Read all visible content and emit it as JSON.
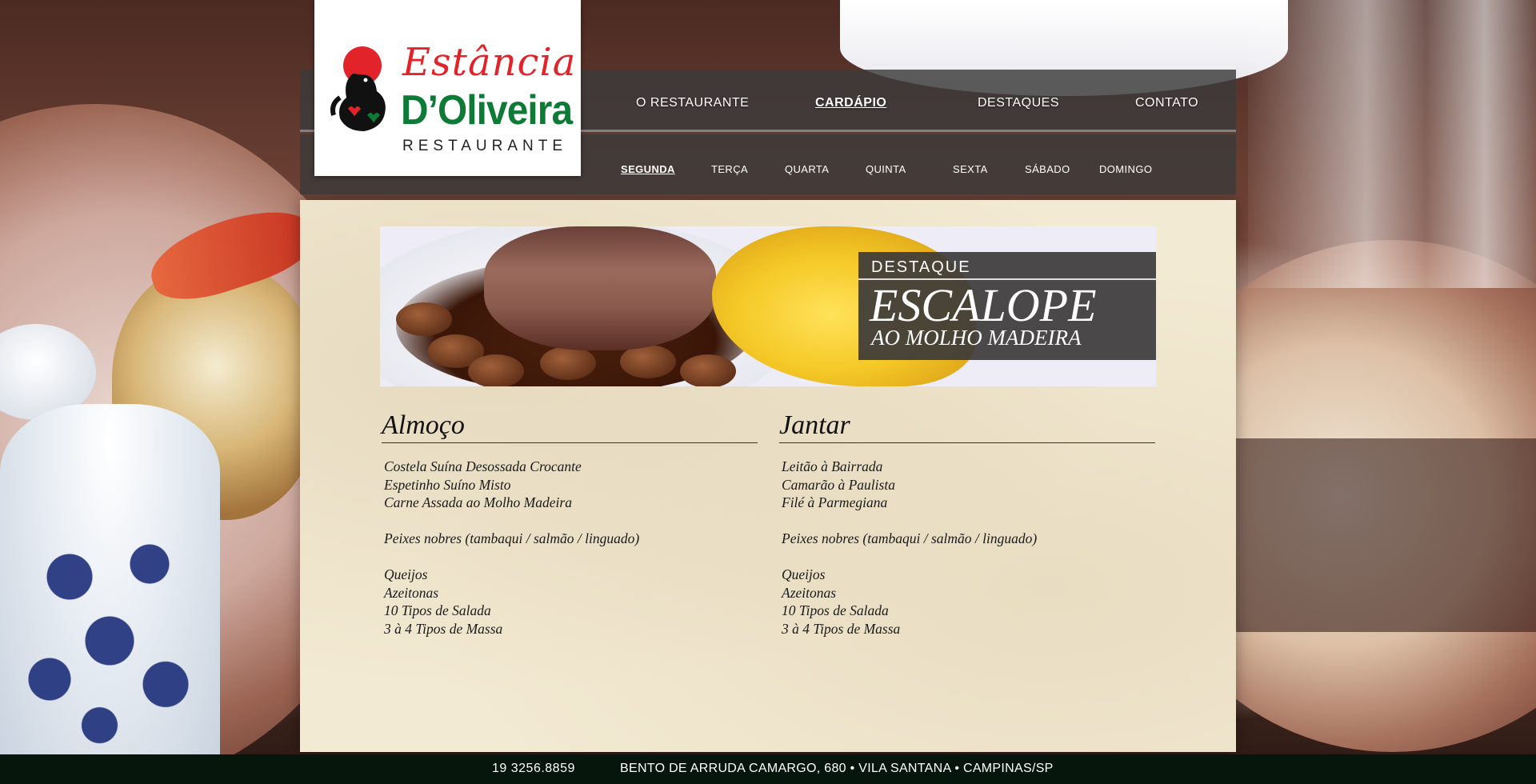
{
  "brand": {
    "name_line1": "Estância",
    "name_line2": "D’Oliveira",
    "name_line3": "RESTAURANTE"
  },
  "nav": {
    "items": [
      {
        "label": "O RESTAURANTE",
        "active": false
      },
      {
        "label": "CARDÁPIO",
        "active": true
      },
      {
        "label": "DESTAQUES",
        "active": false
      },
      {
        "label": "CONTATO",
        "active": false
      }
    ]
  },
  "days": {
    "items": [
      {
        "label": "SEGUNDA",
        "active": true
      },
      {
        "label": "TERÇA",
        "active": false
      },
      {
        "label": "QUARTA",
        "active": false
      },
      {
        "label": "QUINTA",
        "active": false
      },
      {
        "label": "SEXTA",
        "active": false
      },
      {
        "label": "SÁBADO",
        "active": false
      },
      {
        "label": "DOMINGO",
        "active": false
      }
    ]
  },
  "highlight": {
    "label": "DESTAQUE",
    "title": "ESCALOPE",
    "subtitle": "AO MOLHO MADEIRA"
  },
  "menu": {
    "lunch": {
      "title": "Almoço",
      "items": [
        "Costela Suína Desossada Crocante",
        "Espetinho Suíno Misto",
        "Carne Assada ao Molho Madeira",
        "",
        "Peixes nobres (tambaqui / salmão / linguado)",
        "",
        "Queijos",
        "Azeitonas",
        "10 Tipos de Salada",
        "3 à 4 Tipos de Massa"
      ]
    },
    "dinner": {
      "title": "Jantar",
      "items": [
        "Leitão à Bairrada",
        "Camarão à Paulista",
        "Filé à Parmegiana",
        "",
        "Peixes nobres (tambaqui / salmão / linguado)",
        "",
        "Queijos",
        "Azeitonas",
        "10 Tipos de Salada",
        "3 à 4 Tipos de Massa"
      ]
    }
  },
  "footer": {
    "phone": "19  3256.8859",
    "address": "BENTO DE ARRUDA CAMARGO, 680 • VILA SANTANA • CAMPINAS/SP"
  },
  "colors": {
    "brand_red": "#e2232a",
    "brand_green": "#0d7a35",
    "nav_bg": "#3c3a3a",
    "paper": "#f3ead3",
    "footer_bg": "#06160d"
  }
}
